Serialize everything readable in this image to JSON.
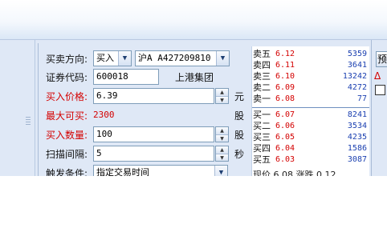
{
  "form": {
    "direction": {
      "label": "买卖方向:",
      "value": "买入"
    },
    "account": {
      "value": "沪A A427209810"
    },
    "code": {
      "label": "证券代码:",
      "value": "600018",
      "stock_name": "上港集团"
    },
    "price": {
      "label": "买入价格:",
      "value": "6.39",
      "unit": "元"
    },
    "max_buy": {
      "label": "最大可买:",
      "value": "2300",
      "unit": "股"
    },
    "quantity": {
      "label": "买入数量:",
      "value": "100",
      "unit": "股"
    },
    "interval": {
      "label": "扫描间隔:",
      "value": "5",
      "unit": "秒"
    },
    "trigger": {
      "label": "触发条件:",
      "value": "指定交易时间"
    }
  },
  "quotes": {
    "sell": [
      {
        "name": "卖五",
        "price": "6.12",
        "volume": "5359"
      },
      {
        "name": "卖四",
        "price": "6.11",
        "volume": "3641"
      },
      {
        "name": "卖三",
        "price": "6.10",
        "volume": "13242"
      },
      {
        "name": "卖二",
        "price": "6.09",
        "volume": "4272"
      },
      {
        "name": "卖一",
        "price": "6.08",
        "volume": "77"
      }
    ],
    "buy": [
      {
        "name": "买一",
        "price": "6.07",
        "volume": "8241"
      },
      {
        "name": "买二",
        "price": "6.06",
        "volume": "3534"
      },
      {
        "name": "买三",
        "price": "6.05",
        "volume": "4235"
      },
      {
        "name": "买四",
        "price": "6.04",
        "volume": "1586"
      },
      {
        "name": "买五",
        "price": "6.03",
        "volume": "3087"
      }
    ],
    "footer": "现价 6.08 涨跌 0.12"
  },
  "right": {
    "button_label": "预",
    "warn_icon": "Δ"
  },
  "colors": {
    "down_price": "#d40000",
    "volume": "#1a3fb0",
    "panel_bg": "#dfe8f6"
  }
}
